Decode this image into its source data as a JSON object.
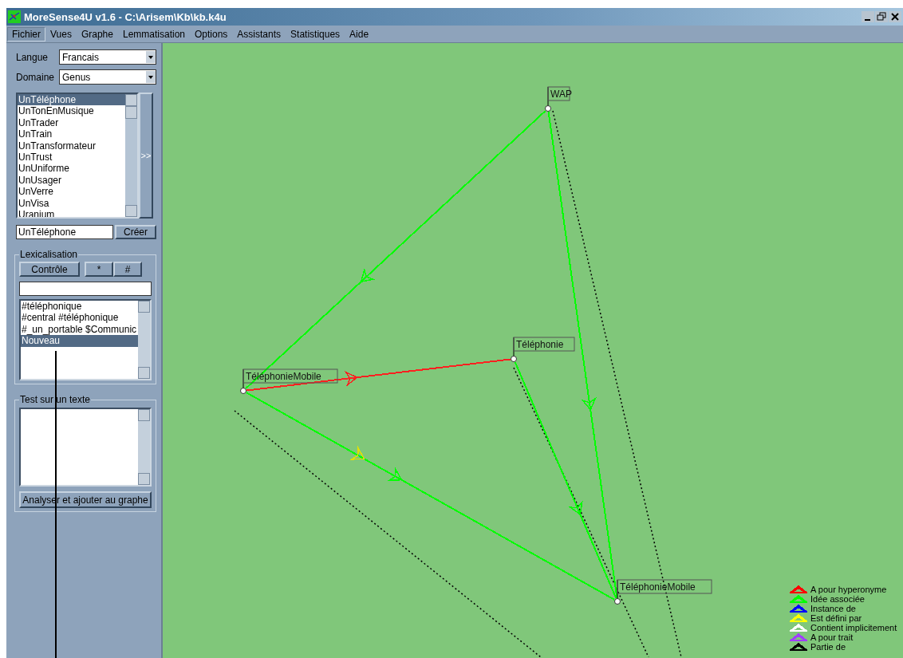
{
  "window": {
    "title": "MoreSense4U v1.6 - C:\\Arisem\\Kb\\kb.k4u"
  },
  "menu": [
    {
      "label": "Fichier",
      "selected": true
    },
    {
      "label": "Vues",
      "selected": false
    },
    {
      "label": "Graphe",
      "selected": false
    },
    {
      "label": "Lemmatisation",
      "selected": false
    },
    {
      "label": "Options",
      "selected": false
    },
    {
      "label": "Assistants",
      "selected": false
    },
    {
      "label": "Statistiques",
      "selected": false
    },
    {
      "label": "Aide",
      "selected": false
    }
  ],
  "sidebar": {
    "langue": {
      "label": "Langue",
      "value": "Francais"
    },
    "domaine": {
      "label": "Domaine",
      "value": "Genus"
    },
    "concepts": [
      {
        "label": "UnTéléphone",
        "selected": true
      },
      {
        "label": "UnTonEnMusique",
        "selected": false
      },
      {
        "label": "UnTrader",
        "selected": false
      },
      {
        "label": "UnTrain",
        "selected": false
      },
      {
        "label": "UnTransformateur",
        "selected": false
      },
      {
        "label": "UnTrust",
        "selected": false
      },
      {
        "label": "UnUniforme",
        "selected": false
      },
      {
        "label": "UnUsager",
        "selected": false
      },
      {
        "label": "UnVerre",
        "selected": false
      },
      {
        "label": "UnVisa",
        "selected": false
      },
      {
        "label": "Uranium",
        "selected": false
      }
    ],
    "expand_button": ">>",
    "name_field": "UnTéléphone",
    "create_button": "Créer",
    "lexicalisation": {
      "title": "Lexicalisation",
      "buttons": [
        "Contrôle",
        "*",
        "#"
      ],
      "items": [
        {
          "label": "#téléphonique",
          "selected": false
        },
        {
          "label": "#central #téléphonique",
          "selected": false
        },
        {
          "label": "#_un_portable $Communic",
          "selected": false
        },
        {
          "label": "Nouveau",
          "selected": true
        }
      ]
    },
    "test": {
      "title": "Test sur un texte",
      "button": "Analyser et ajouter au graphe"
    }
  },
  "graph": {
    "nodes": [
      {
        "label": "WAP"
      },
      {
        "label": "Téléphonie"
      },
      {
        "label": "TéléphonieMobile"
      },
      {
        "label": "TéléphonieMobile"
      }
    ],
    "edges": [
      {
        "color": "#00ff00"
      },
      {
        "color": "#ff2020"
      },
      {
        "color": "#00ff00"
      },
      {
        "color": "#00ff00"
      },
      {
        "color": "#00ff00"
      },
      {
        "color": "#e0e000"
      }
    ],
    "legend": [
      {
        "label": "A pour hyperonyme",
        "color": "#ff0000"
      },
      {
        "label": "Idée associée",
        "color": "#00ff00"
      },
      {
        "label": "Instance de",
        "color": "#0000ff"
      },
      {
        "label": "Est défini par",
        "color": "#ffff00"
      },
      {
        "label": "Contient implicitement",
        "color": "#ffffff"
      },
      {
        "label": "A pour trait",
        "color": "#a040ff"
      },
      {
        "label": "Partie de",
        "color": "#000000"
      }
    ]
  }
}
